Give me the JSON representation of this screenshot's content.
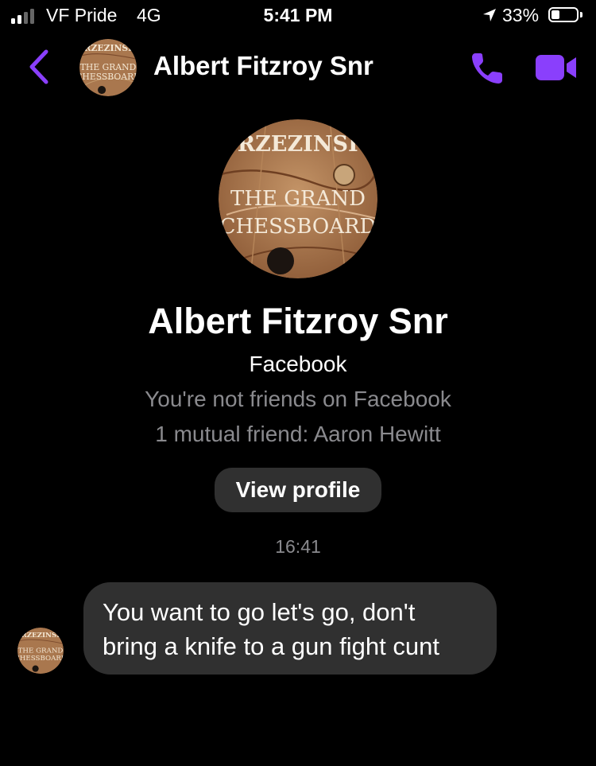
{
  "status_bar": {
    "carrier": "VF Pride",
    "network": "4G",
    "time": "5:41 PM",
    "battery_percent": "33%",
    "battery_level": 0.33,
    "signal_bars_active": 2,
    "signal_bars_total": 4
  },
  "header": {
    "contact_name": "Albert Fitzroy Snr",
    "back_icon": "chevron-left-icon",
    "call_icon": "phone-icon",
    "video_icon": "video-camera-icon"
  },
  "avatar": {
    "author": "BRZEZINSKI",
    "title_line1": "THE GRAND",
    "title_line2": "CHESSBOARD"
  },
  "profile": {
    "name": "Albert Fitzroy Snr",
    "source": "Facebook",
    "friend_status": "You're not friends on Facebook",
    "mutual": "1 mutual friend: Aaron Hewitt",
    "view_profile_label": "View profile"
  },
  "conversation": {
    "timestamp": "16:41",
    "messages": [
      {
        "sender": "Albert Fitzroy Snr",
        "text": "You want to go let's go, don't\nbring a knife to a gun fight cunt"
      }
    ]
  },
  "colors": {
    "accent": "#8a3ffc",
    "bubble": "#303030",
    "muted_text": "#8a8a8e",
    "background": "#000000"
  }
}
